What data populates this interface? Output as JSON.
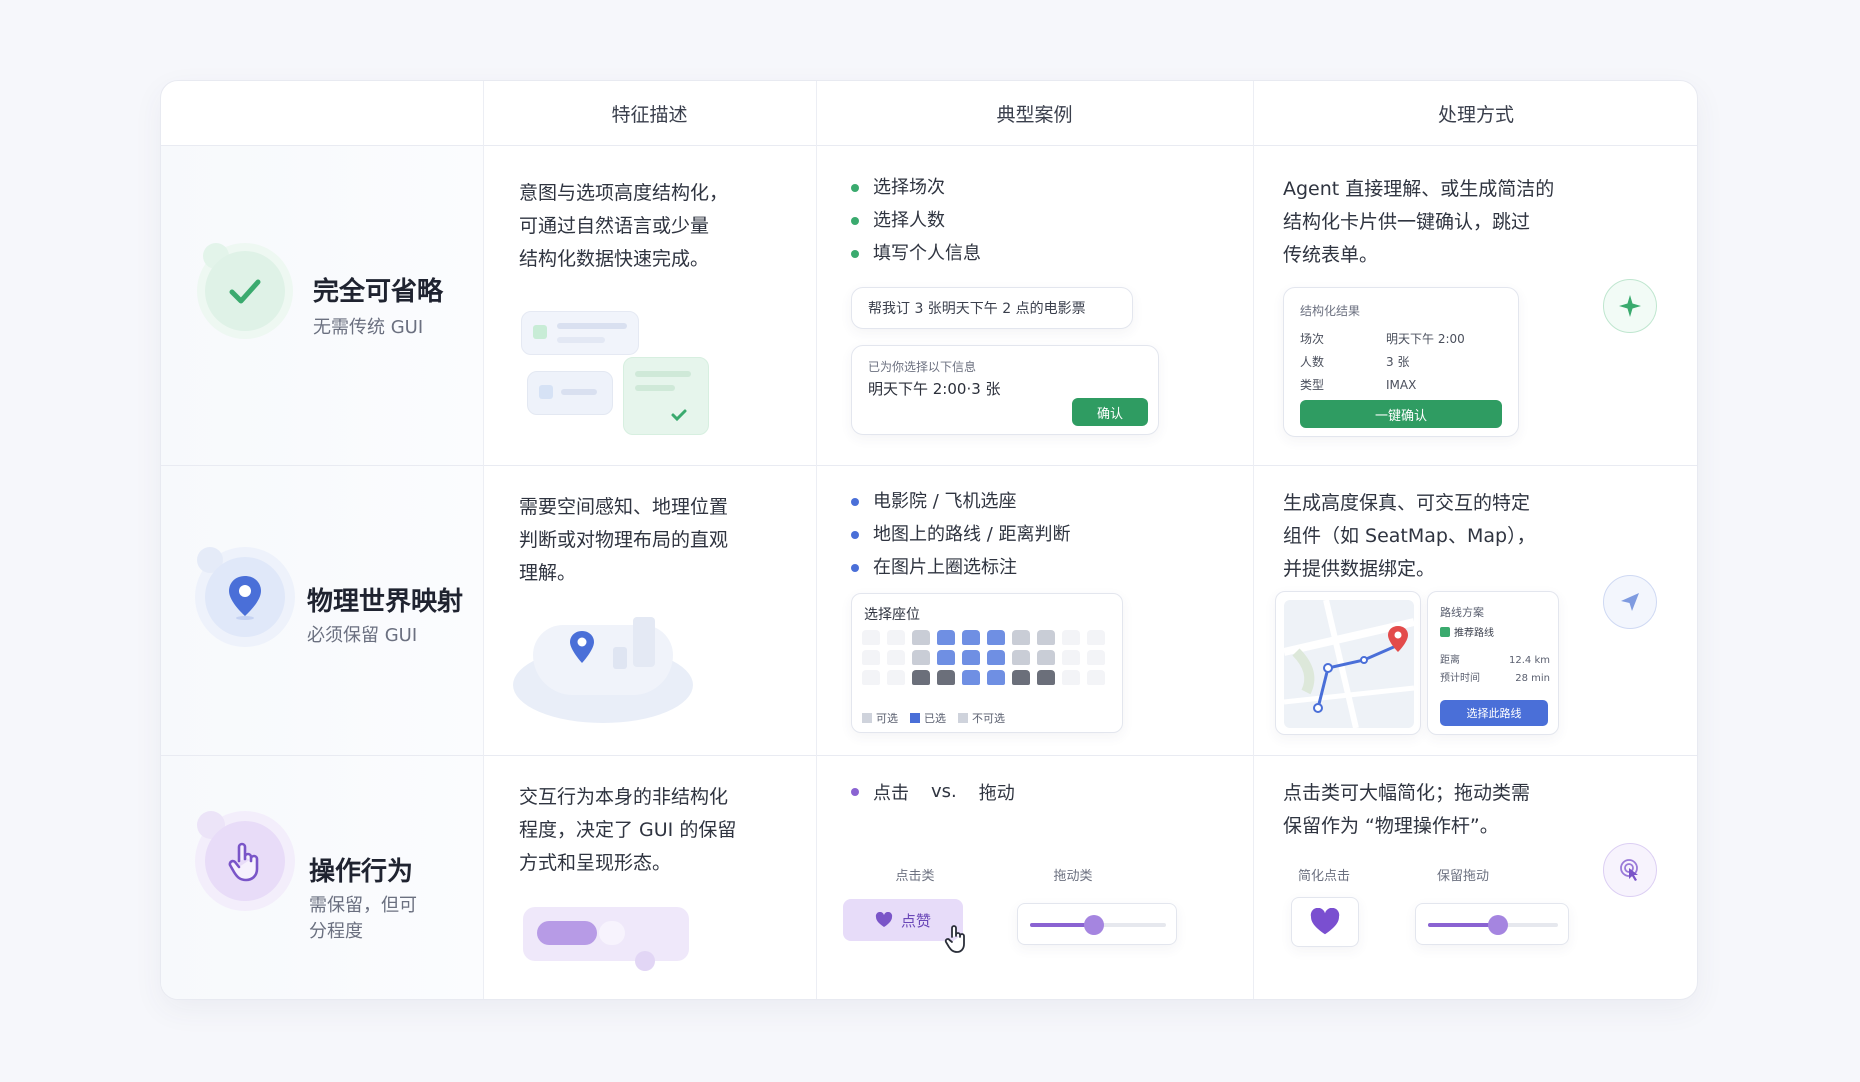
{
  "headers": [
    "特征描述",
    "典型案例",
    "处理方式"
  ],
  "rows": [
    {
      "title": "完全可省略",
      "subtitle": "无需传统 GUI",
      "description": [
        "意图与选项高度结构化，",
        "可通过自然语言或少量",
        "结构化数据快速完成。"
      ],
      "examples": [
        "选择场次",
        "选择人数",
        "填写个人信息"
      ],
      "chat_query": "帮我订 3 张明天下午 2 点的电影票",
      "reply_label": "已为你选择以下信息",
      "reply_value": "明天下午 2:00·3 张",
      "reply_button": "确认",
      "handling": [
        "Agent 直接理解、或生成简洁的",
        "结构化卡片供一键确认，跳过",
        "传统表单。"
      ],
      "result_card": {
        "title": "结构化结果",
        "rows": [
          {
            "k": "场次",
            "v": "明天下午 2:00"
          },
          {
            "k": "人数",
            "v": "3 张"
          },
          {
            "k": "类型",
            "v": "IMAX"
          }
        ],
        "button": "一键确认"
      },
      "accent": "#3aaa6e",
      "icon": "check-icon",
      "side_icon": "sparkle-icon"
    },
    {
      "title": "物理世界映射",
      "subtitle": "必须保留 GUI",
      "description": [
        "需要空间感知、地理位置",
        "判断或对物理布局的直观",
        "理解。"
      ],
      "examples": [
        "电影院 / 飞机选座",
        "地图上的路线 / 距离判断",
        "在图片上圈选标注"
      ],
      "seat_title": "选择座位",
      "seat_legend": [
        "可选",
        "已选",
        "不可选"
      ],
      "handling": [
        "生成高度保真、可交互的特定",
        "组件（如 SeatMap、Map），",
        "并提供数据绑定。"
      ],
      "route_card": {
        "title": "路线方案",
        "recommended": "推荐路线",
        "rows": [
          {
            "k": "距离",
            "v": "12.4 km"
          },
          {
            "k": "预计时间",
            "v": "28 min"
          }
        ],
        "button": "选择此路线"
      },
      "accent": "#4a6fd8",
      "icon": "location-pin-icon",
      "side_icon": "send-icon"
    },
    {
      "title": "操作行为",
      "subtitle": [
        "需保留，但可",
        "分程度"
      ],
      "description": [
        "交互行为本身的非结构化",
        "程度，决定了 GUI 的保留",
        "方式和呈现形态。"
      ],
      "example_line": {
        "a": "点击",
        "vs": "vs.",
        "b": "拖动"
      },
      "click_label": "点击类",
      "drag_label": "拖动类",
      "like_button": "点赞",
      "handling": [
        "点击类可大幅简化；拖动类需",
        "保留作为 “物理操作杆”。"
      ],
      "simplify_label": "简化点击",
      "keep_drag_label": "保留拖动",
      "accent": "#8a63d2",
      "icon": "hand-pointer-icon",
      "side_icon": "touch-icon"
    }
  ]
}
